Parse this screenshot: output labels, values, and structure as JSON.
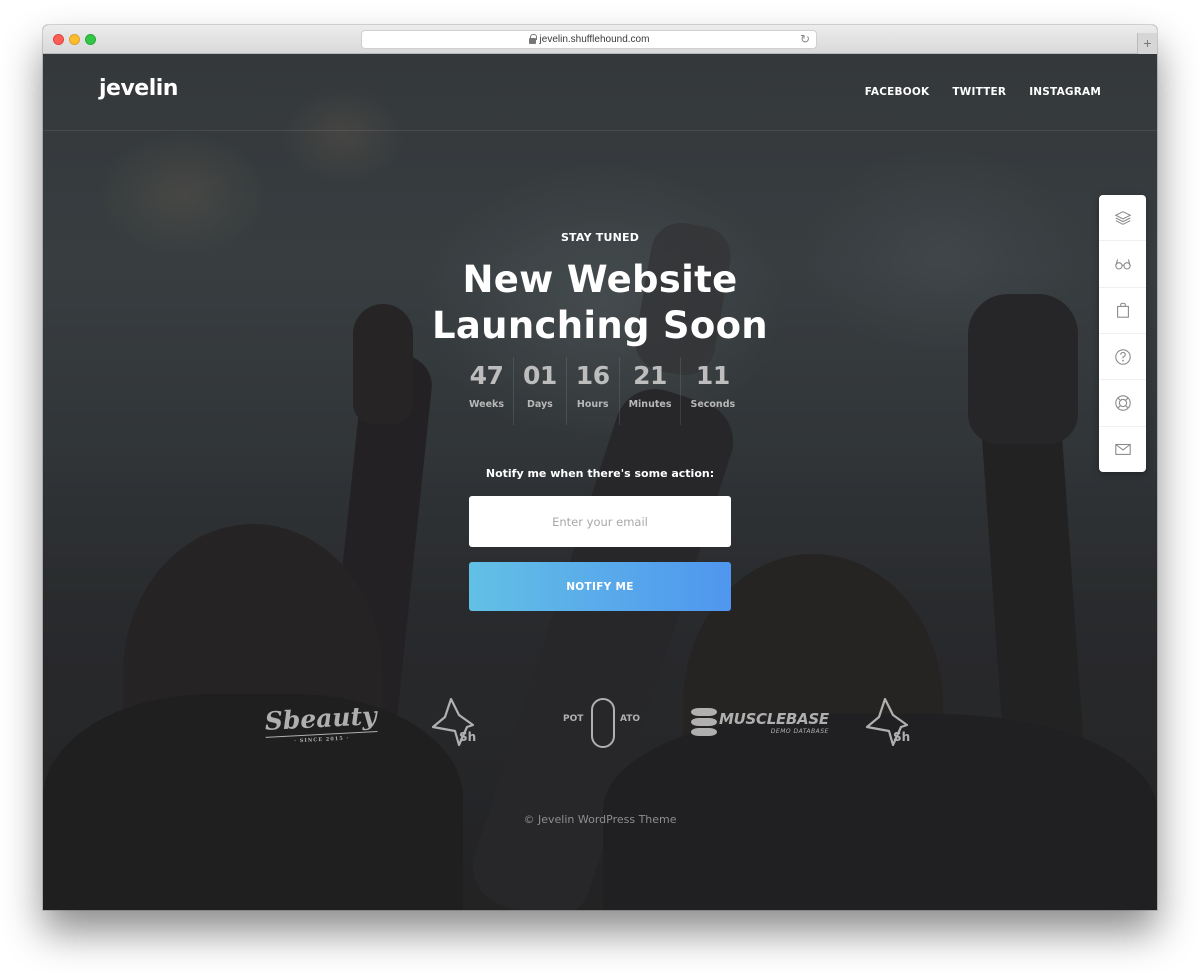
{
  "browser": {
    "url": "jevelin.shufflehound.com",
    "new_tab_label": "+"
  },
  "header": {
    "logo": "jevelin",
    "nav": [
      {
        "label": "FACEBOOK"
      },
      {
        "label": "TWITTER"
      },
      {
        "label": "INSTAGRAM"
      }
    ]
  },
  "side_panel": {
    "items": [
      {
        "icon": "layers-icon"
      },
      {
        "icon": "glasses-icon"
      },
      {
        "icon": "shopping-bag-icon"
      },
      {
        "icon": "help-icon"
      },
      {
        "icon": "lifebuoy-icon"
      },
      {
        "icon": "mail-icon"
      }
    ]
  },
  "hero": {
    "eyebrow": "STAY TUNED",
    "title_line1": "New Website",
    "title_line2": "Launching Soon"
  },
  "countdown": [
    {
      "value": "47",
      "label": "Weeks"
    },
    {
      "value": "01",
      "label": "Days"
    },
    {
      "value": "16",
      "label": "Hours"
    },
    {
      "value": "21",
      "label": "Minutes"
    },
    {
      "value": "11",
      "label": "Seconds"
    }
  ],
  "subscribe": {
    "label": "Notify me when there's some action:",
    "email_placeholder": "Enter your email",
    "email_value": "",
    "button_label": "NOTIFY ME",
    "button_gradient": [
      "#63c0e5",
      "#4f96ef"
    ]
  },
  "brands": {
    "sbeauty": {
      "name": "Sbeauty",
      "tagline": "· SINCE 2015 ·"
    },
    "sh": {
      "name": "Sh"
    },
    "potato": {
      "left": "POT",
      "right": "ATO"
    },
    "musclebase": {
      "name": "MUSCLEBASE",
      "tagline": "DEMO DATABASE"
    }
  },
  "footer": {
    "copyright": "© Jevelin WordPress Theme"
  }
}
